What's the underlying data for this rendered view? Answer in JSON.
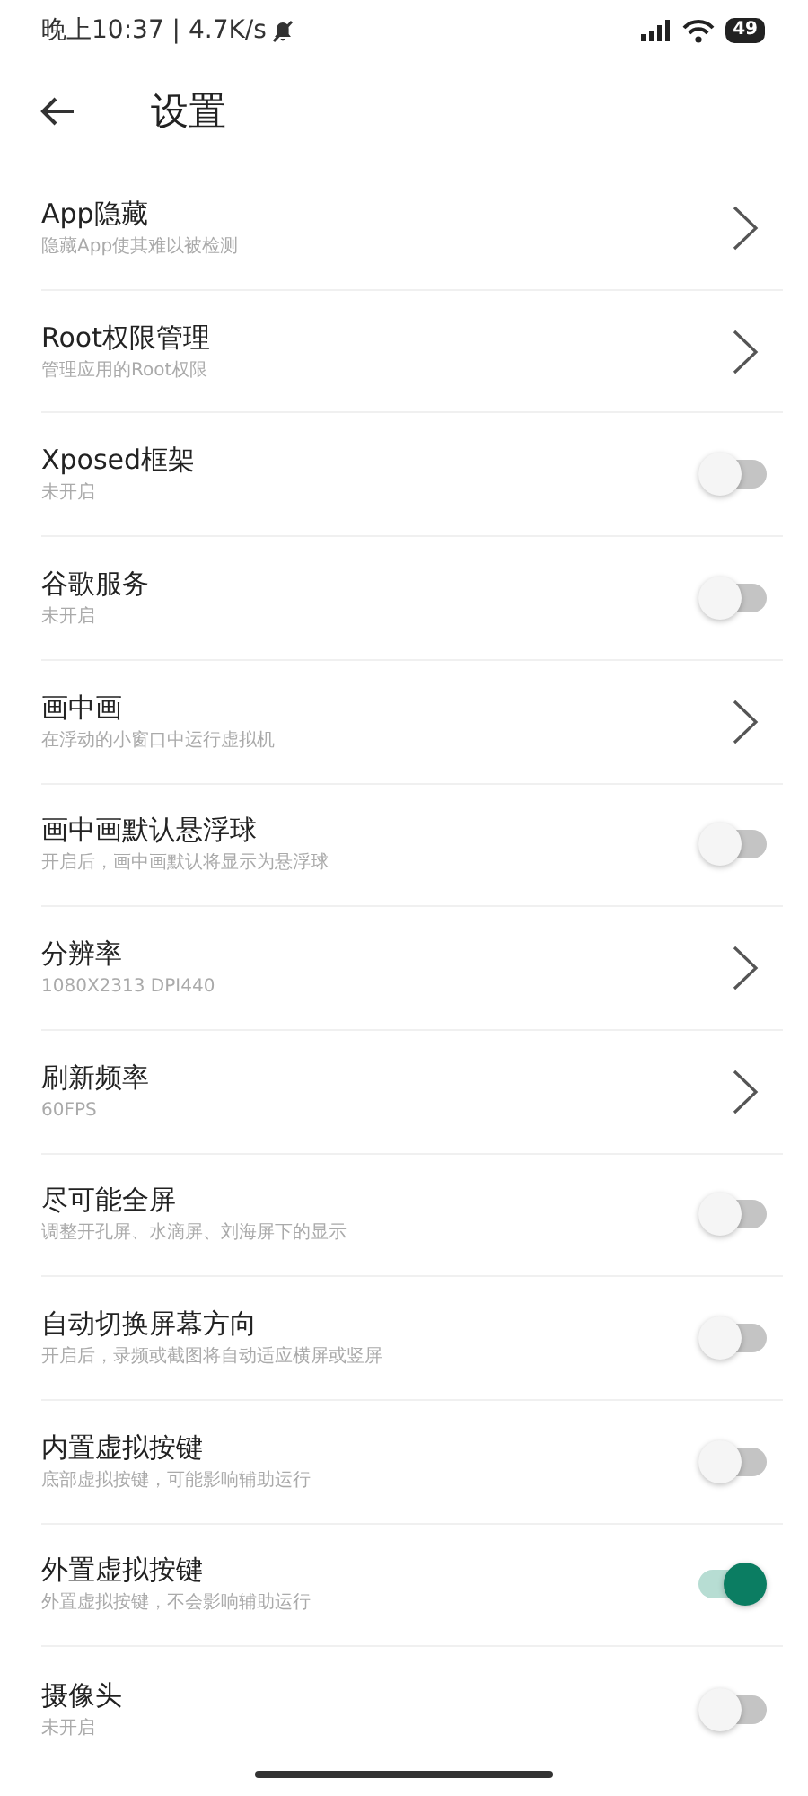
{
  "status_bar": {
    "time": "晚上10:37 | 4.7K/s",
    "battery": "49"
  },
  "header": {
    "title": "设置"
  },
  "settings": [
    {
      "kind": "link",
      "title": "App隐藏",
      "subtitle": "隐藏App使其难以被检测"
    },
    {
      "kind": "link",
      "title": "Root权限管理",
      "subtitle": "管理应用的Root权限"
    },
    {
      "kind": "toggle",
      "title": "Xposed框架",
      "subtitle": "未开启",
      "on": false
    },
    {
      "kind": "toggle",
      "title": "谷歌服务",
      "subtitle": "未开启",
      "on": false
    },
    {
      "kind": "link",
      "title": "画中画",
      "subtitle": "在浮动的小窗口中运行虚拟机"
    },
    {
      "kind": "toggle",
      "title": "画中画默认悬浮球",
      "subtitle": "开启后，画中画默认将显示为悬浮球",
      "on": false
    },
    {
      "kind": "link",
      "title": "分辨率",
      "subtitle": "1080X2313 DPI440"
    },
    {
      "kind": "link",
      "title": "刷新频率",
      "subtitle": "60FPS"
    },
    {
      "kind": "toggle",
      "title": "尽可能全屏",
      "subtitle": "调整开孔屏、水滴屏、刘海屏下的显示",
      "on": false
    },
    {
      "kind": "toggle",
      "title": "自动切换屏幕方向",
      "subtitle": "开启后，录频或截图将自动适应横屏或竖屏",
      "on": false
    },
    {
      "kind": "toggle",
      "title": "内置虚拟按键",
      "subtitle": "底部虚拟按键，可能影响辅助运行",
      "on": false
    },
    {
      "kind": "toggle",
      "title": "外置虚拟按键",
      "subtitle": "外置虚拟按键，不会影响辅助运行",
      "on": true
    },
    {
      "kind": "toggle",
      "title": "摄像头",
      "subtitle": "未开启",
      "on": false
    }
  ]
}
